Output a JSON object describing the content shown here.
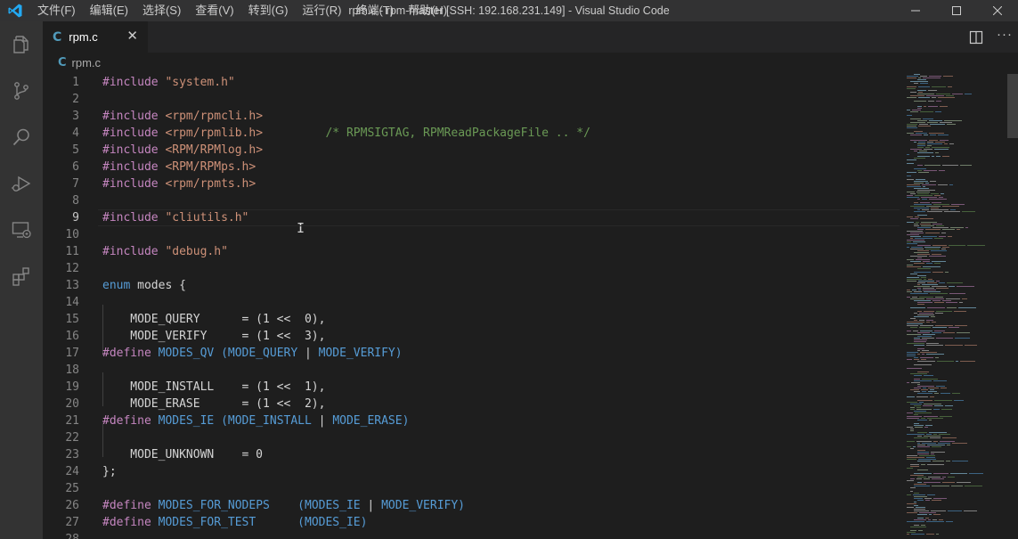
{
  "window": {
    "title": "rpm.c - rpm-master [SSH: 192.168.231.149] - Visual Studio Code",
    "minimize": "—",
    "maximize": "☐",
    "close": "✕"
  },
  "menu": [
    "文件(F)",
    "编辑(E)",
    "选择(S)",
    "查看(V)",
    "转到(G)",
    "运行(R)",
    "终端(T)",
    "帮助(H)"
  ],
  "activity_icons": [
    "explorer-icon",
    "source-control-icon",
    "search-icon",
    "run-debug-icon",
    "remote-explorer-icon",
    "extensions-icon"
  ],
  "tab": {
    "icon": "C",
    "label": "rpm.c",
    "close": "✕"
  },
  "breadcrumb": {
    "icon": "C",
    "label": "rpm.c"
  },
  "editor": {
    "active_line": 9,
    "lines": [
      {
        "n": "1",
        "segs": [
          [
            "kw",
            "#include"
          ],
          [
            "",
            ""
          ],
          [
            "str",
            " \"system.h\""
          ]
        ]
      },
      {
        "n": "2",
        "segs": []
      },
      {
        "n": "3",
        "segs": [
          [
            "kw",
            "#include"
          ],
          [
            "str",
            " <rpm/rpmcli.h>"
          ]
        ]
      },
      {
        "n": "4",
        "segs": [
          [
            "kw",
            "#include"
          ],
          [
            "str",
            " <rpm/rpmlib.h>"
          ],
          [
            "",
            "         "
          ],
          [
            "cmt",
            "/* RPMSIGTAG, RPMReadPackageFile .. */"
          ]
        ]
      },
      {
        "n": "5",
        "segs": [
          [
            "kw",
            "#include"
          ],
          [
            "str",
            " <RPM/RPMlog.h>"
          ]
        ]
      },
      {
        "n": "6",
        "segs": [
          [
            "kw",
            "#include"
          ],
          [
            "str",
            " <RPM/RPMps.h>"
          ]
        ]
      },
      {
        "n": "7",
        "segs": [
          [
            "kw",
            "#include"
          ],
          [
            "str",
            " <rpm/rpmts.h>"
          ]
        ]
      },
      {
        "n": "8",
        "segs": []
      },
      {
        "n": "9",
        "segs": [
          [
            "kw",
            "#include"
          ],
          [
            "str",
            " \"cliutils.h\""
          ]
        ]
      },
      {
        "n": "10",
        "segs": []
      },
      {
        "n": "11",
        "segs": [
          [
            "kw",
            "#include"
          ],
          [
            "str",
            " \"debug.h\""
          ]
        ]
      },
      {
        "n": "12",
        "segs": []
      },
      {
        "n": "13",
        "segs": [
          [
            "blue",
            "enum"
          ],
          [
            "",
            " modes {"
          ]
        ]
      },
      {
        "n": "14",
        "segs": []
      },
      {
        "n": "15",
        "segs": [
          [
            "",
            "    MODE_QUERY      = (1 <<  0),"
          ]
        ]
      },
      {
        "n": "16",
        "segs": [
          [
            "",
            "    MODE_VERIFY     = (1 <<  3),"
          ]
        ]
      },
      {
        "n": "17",
        "segs": [
          [
            "kw",
            "#define"
          ],
          [
            "macro",
            " MODES_QV"
          ],
          [
            "macro",
            " (MODE_QUERY"
          ],
          [
            "",
            " | "
          ],
          [
            "macro",
            "MODE_VERIFY)"
          ]
        ]
      },
      {
        "n": "18",
        "segs": []
      },
      {
        "n": "19",
        "segs": [
          [
            "",
            "    MODE_INSTALL    = (1 <<  1),"
          ]
        ]
      },
      {
        "n": "20",
        "segs": [
          [
            "",
            "    MODE_ERASE      = (1 <<  2),"
          ]
        ]
      },
      {
        "n": "21",
        "segs": [
          [
            "kw",
            "#define"
          ],
          [
            "macro",
            " MODES_IE"
          ],
          [
            "macro",
            " (MODE_INSTALL"
          ],
          [
            "",
            " | "
          ],
          [
            "macro",
            "MODE_ERASE)"
          ]
        ]
      },
      {
        "n": "22",
        "segs": []
      },
      {
        "n": "23",
        "segs": [
          [
            "",
            "    MODE_UNKNOWN    = 0"
          ]
        ]
      },
      {
        "n": "24",
        "segs": [
          [
            "",
            "};"
          ]
        ]
      },
      {
        "n": "25",
        "segs": []
      },
      {
        "n": "26",
        "segs": [
          [
            "kw",
            "#define"
          ],
          [
            "macro",
            " MODES_FOR_NODEPS"
          ],
          [
            "macro",
            "    (MODES_IE"
          ],
          [
            "",
            " | "
          ],
          [
            "macro",
            "MODE_VERIFY)"
          ]
        ]
      },
      {
        "n": "27",
        "segs": [
          [
            "kw",
            "#define"
          ],
          [
            "macro",
            " MODES_FOR_TEST"
          ],
          [
            "macro",
            "      (MODES_IE)"
          ]
        ]
      },
      {
        "n": "28",
        "segs": []
      }
    ]
  },
  "colors": {
    "editor_bg": "#1e1e1e",
    "title_bar": "#323233",
    "activity_bar": "#333333",
    "keyword": "#c586c0",
    "string": "#ce9178",
    "comment": "#6a9955",
    "macro": "#569cd6",
    "vscode_blue": "#0065a9"
  }
}
